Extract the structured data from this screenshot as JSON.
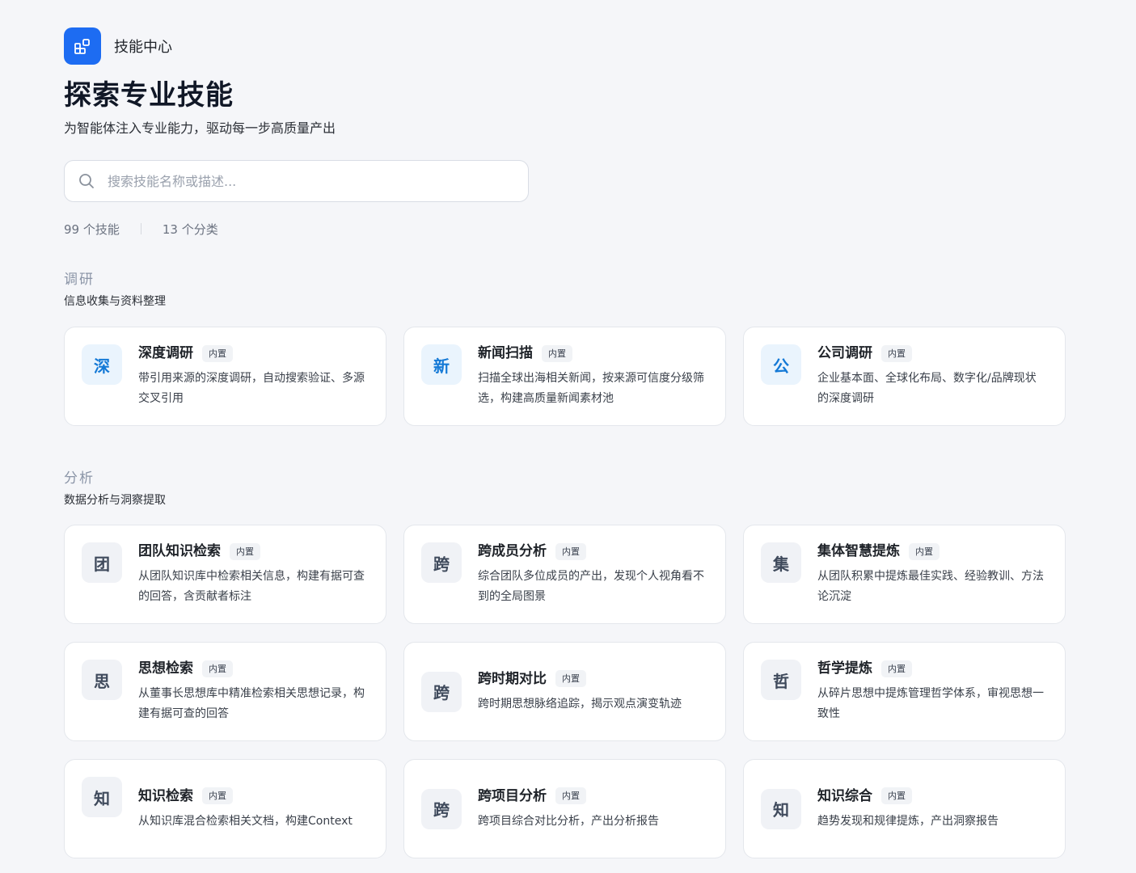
{
  "brand": {
    "name": "技能中心",
    "logo_icon": "grid-squares-icon"
  },
  "page": {
    "title": "探索专业技能",
    "subtitle": "为智能体注入专业能力，驱动每一步高质量产出"
  },
  "search": {
    "placeholder": "搜索技能名称或描述...",
    "value": ""
  },
  "stats": {
    "skills": "99 个技能",
    "categories": "13 个分类"
  },
  "sections": [
    {
      "title": "调研",
      "desc": "信息收集与资料整理",
      "cards": [
        {
          "icon": "深",
          "title": "深度调研",
          "badge": "内置",
          "desc": "带引用来源的深度调研，自动搜索验证、多源交叉引用"
        },
        {
          "icon": "新",
          "title": "新闻扫描",
          "badge": "内置",
          "desc": "扫描全球出海相关新闻，按来源可信度分级筛选，构建高质量新闻素材池"
        },
        {
          "icon": "公",
          "title": "公司调研",
          "badge": "内置",
          "desc": "企业基本面、全球化布局、数字化/品牌现状的深度调研"
        }
      ]
    },
    {
      "title": "分析",
      "desc": "数据分析与洞察提取",
      "cards": [
        {
          "icon": "团",
          "title": "团队知识检索",
          "badge": "内置",
          "desc": "从团队知识库中检索相关信息，构建有据可查的回答，含贡献者标注"
        },
        {
          "icon": "跨",
          "title": "跨成员分析",
          "badge": "内置",
          "desc": "综合团队多位成员的产出，发现个人视角看不到的全局图景"
        },
        {
          "icon": "集",
          "title": "集体智慧提炼",
          "badge": "内置",
          "desc": "从团队积累中提炼最佳实践、经验教训、方法论沉淀"
        },
        {
          "icon": "思",
          "title": "思想检索",
          "badge": "内置",
          "desc": "从董事长思想库中精准检索相关思想记录，构建有据可查的回答"
        },
        {
          "icon": "跨",
          "title": "跨时期对比",
          "badge": "内置",
          "desc": "跨时期思想脉络追踪，揭示观点演变轨迹"
        },
        {
          "icon": "哲",
          "title": "哲学提炼",
          "badge": "内置",
          "desc": "从碎片思想中提炼管理哲学体系，审视思想一致性"
        },
        {
          "icon": "知",
          "title": "知识检索",
          "badge": "内置",
          "desc": "从知识库混合检索相关文档，构建Context"
        },
        {
          "icon": "跨",
          "title": "跨项目分析",
          "badge": "内置",
          "desc": "跨项目综合对比分析，产出分析报告"
        },
        {
          "icon": "知",
          "title": "知识综合",
          "badge": "内置",
          "desc": "趋势发现和规律提炼，产出洞察报告"
        }
      ]
    }
  ],
  "colors": {
    "accent": "#1d6cf2",
    "research_icon": "#1479d6",
    "analysis_icon": "#3f4a5c",
    "background": "#f5f6f9"
  }
}
